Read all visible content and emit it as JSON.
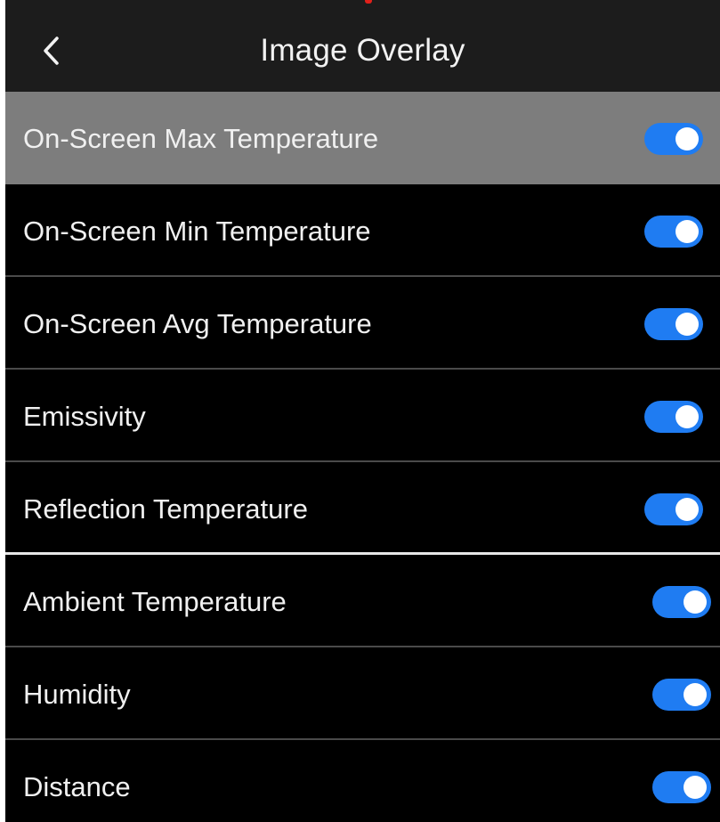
{
  "header": {
    "title": "Image Overlay",
    "back_icon": "chevron-left-icon"
  },
  "accent_color": "#1f7cf2",
  "items": [
    {
      "label": "On-Screen Max Temperature",
      "enabled": true,
      "selected": true
    },
    {
      "label": "On-Screen Min Temperature",
      "enabled": true,
      "selected": false
    },
    {
      "label": "On-Screen Avg Temperature",
      "enabled": true,
      "selected": false
    },
    {
      "label": "Emissivity",
      "enabled": true,
      "selected": false
    },
    {
      "label": "Reflection Temperature",
      "enabled": true,
      "selected": false
    },
    {
      "label": "Ambient Temperature",
      "enabled": true,
      "selected": false
    },
    {
      "label": "Humidity",
      "enabled": true,
      "selected": false
    },
    {
      "label": "Distance",
      "enabled": true,
      "selected": false
    }
  ]
}
